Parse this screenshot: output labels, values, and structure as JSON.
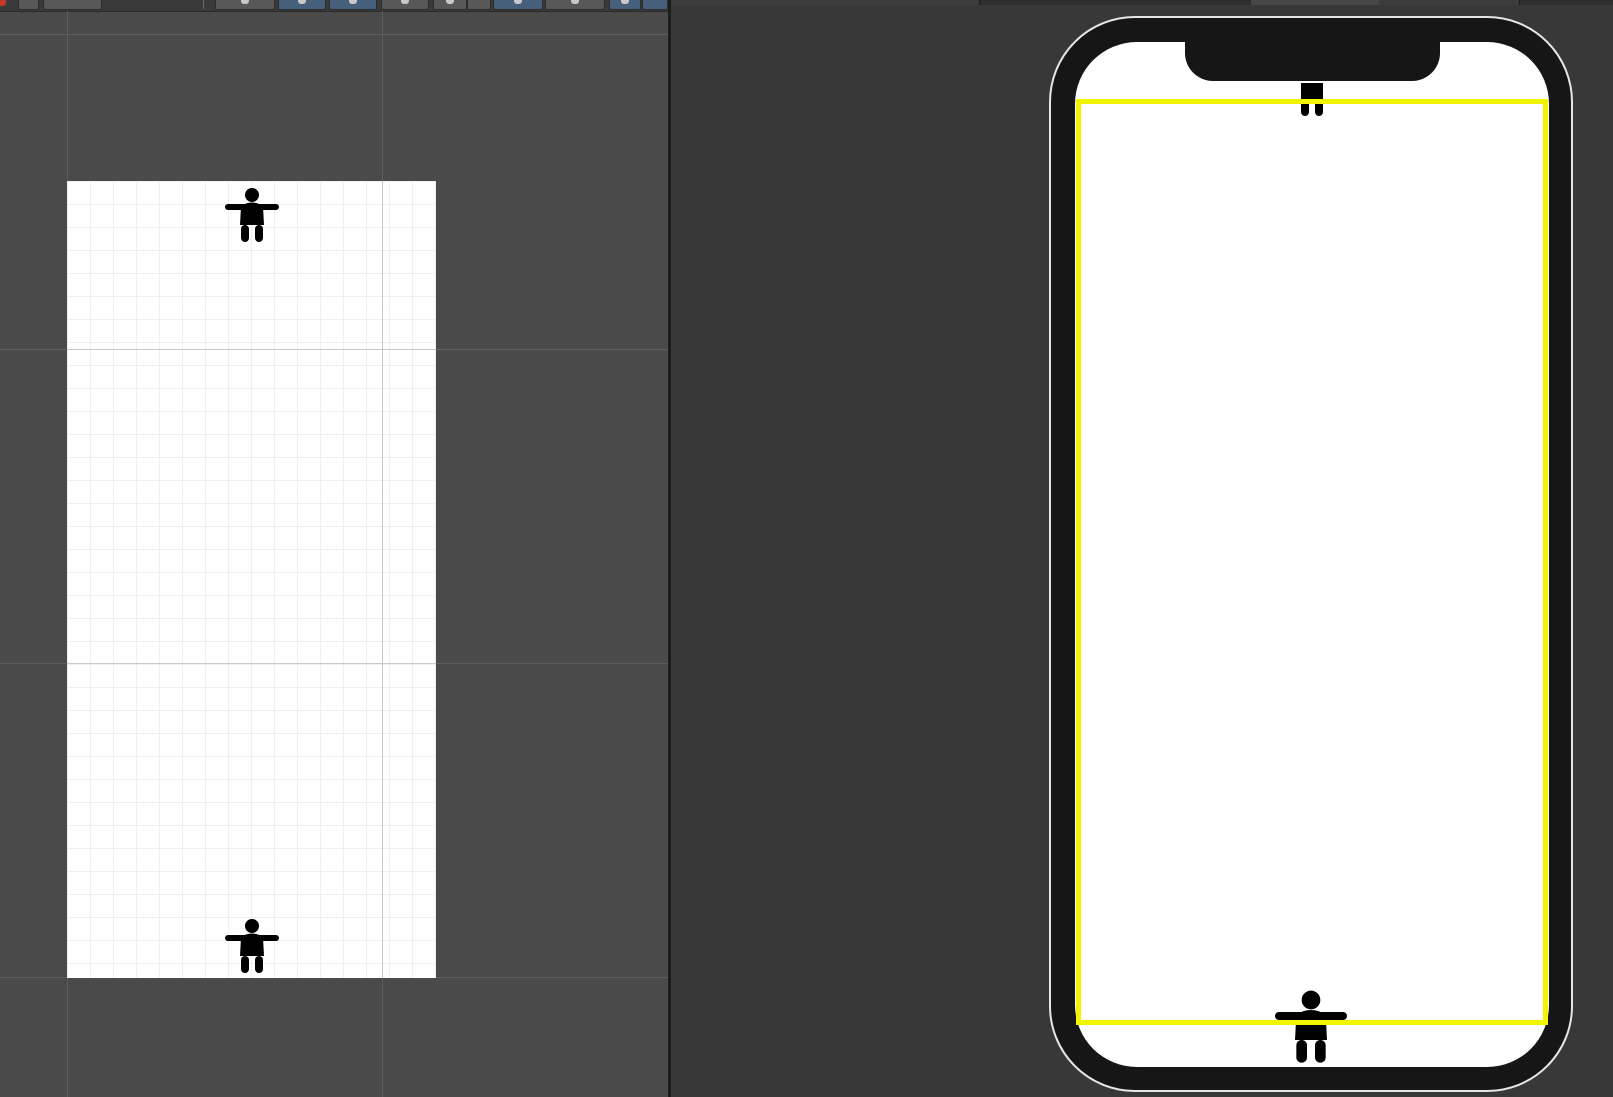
{
  "scene_view": {
    "toolbar_icons": [
      "undo-icon",
      "dropdown",
      "shading-icon",
      "2d-toggle-icon",
      "lighting-icon",
      "audio-icon",
      "effects-icon",
      "hidden-objects-icon",
      "scene-camera-icon",
      "gizmos-icon",
      "globe-icon",
      "settings-icon"
    ],
    "canvas_background": "#ffffff",
    "grid_line_color": "#c8c8c8",
    "viewport_background": "#4a4a4a",
    "characters": [
      "character-top",
      "character-bottom"
    ]
  },
  "game_view": {
    "device": "phone-with-notch",
    "safe_area_color": "#f2f400",
    "bezel_color": "#161616",
    "outline_color": "#e6e6e6",
    "characters": [
      "character-top-clipped",
      "character-bottom"
    ]
  },
  "colors": {
    "panel_dark": "#383838",
    "toolbar_active": "#46607c",
    "toolbar_button": "#585858",
    "character": "#000000"
  }
}
